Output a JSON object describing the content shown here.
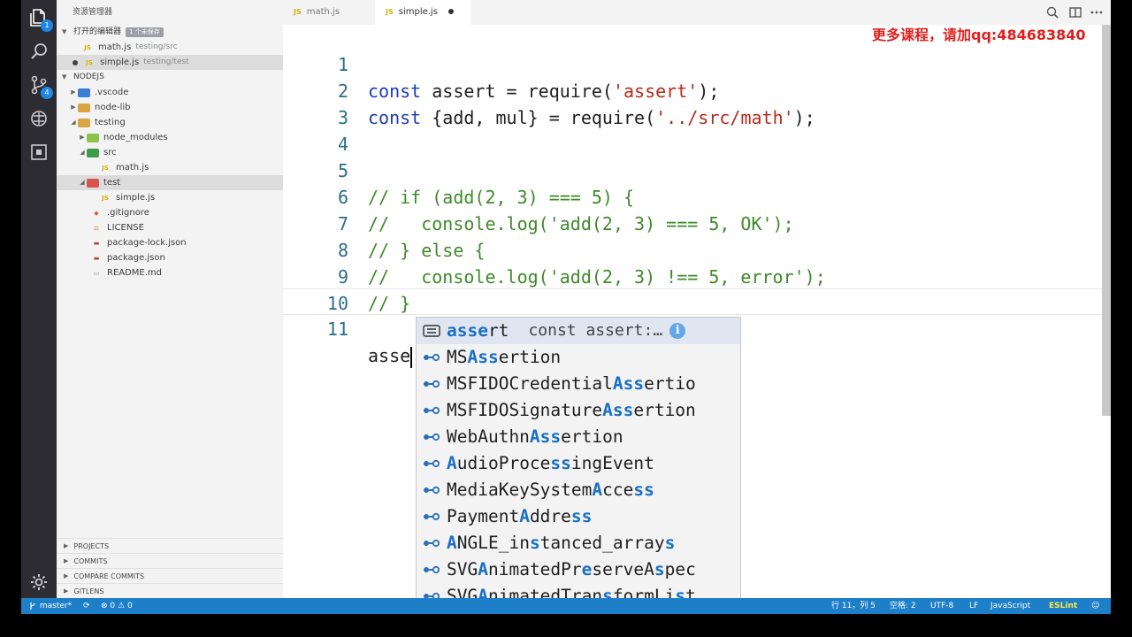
{
  "sidebar": {
    "title": "资源管理器",
    "open_editors": {
      "label": "打开的编辑器",
      "badge": "1 个未保存",
      "items": [
        {
          "name": "math.js",
          "path": "testing/src",
          "modified": false
        },
        {
          "name": "simple.js",
          "path": "testing/test",
          "modified": true
        }
      ]
    },
    "project": {
      "label": "NODEJS",
      "tree": [
        {
          "label": ".vscode"
        },
        {
          "label": "node-lib"
        },
        {
          "label": "testing"
        },
        {
          "label": "node_modules"
        },
        {
          "label": "src"
        },
        {
          "label": "math.js"
        },
        {
          "label": "test"
        },
        {
          "label": "simple.js"
        },
        {
          "label": ".gitignore"
        },
        {
          "label": "LICENSE"
        },
        {
          "label": "package-lock.json"
        },
        {
          "label": "package.json"
        },
        {
          "label": "README.md"
        }
      ]
    },
    "panels": [
      "PROJECTS",
      "COMMITS",
      "COMPARE COMMITS",
      "GITLENS"
    ]
  },
  "activity": {
    "explorer_badge": "1",
    "git_badge": "4"
  },
  "tabs": [
    {
      "label": "math.js",
      "active": false
    },
    {
      "label": "simple.js",
      "active": true,
      "modified": true
    }
  ],
  "watermark": "更多课程，请加qq:484683840",
  "code": {
    "line_numbers": [
      "1",
      "2",
      "3",
      "4",
      "5",
      "6",
      "7",
      "8",
      "9",
      "10",
      "11"
    ],
    "l1": {
      "kw": "const",
      "a": " assert = require(",
      "s": "'assert'",
      "b": ");"
    },
    "l2": {
      "kw": "const",
      "a": " {add, mul} = require(",
      "s": "'../src/math'",
      "b": ");"
    },
    "l5": "// if (add(2, 3) === 5) {",
    "l6": "//   console.log('add(2, 3) === 5, OK');",
    "l7": "// } else {",
    "l8": "//   console.log('add(2, 3) !== 5, error');",
    "l9": "// }",
    "l11": "asse"
  },
  "suggest": {
    "first": {
      "match": "asse",
      "rest": "rt",
      "detail": "const assert:…"
    },
    "items": [
      [
        [
          "MS",
          ""
        ],
        [
          "Ass",
          "h"
        ],
        [
          "ertion",
          ""
        ]
      ],
      [
        [
          "MSFIDOCredential",
          ""
        ],
        [
          "Ass",
          "h"
        ],
        [
          "ertio",
          ""
        ]
      ],
      [
        [
          "MSFIDOSignature",
          ""
        ],
        [
          "Ass",
          "h"
        ],
        [
          "ertion",
          ""
        ]
      ],
      [
        [
          "WebAuthn",
          ""
        ],
        [
          "Ass",
          "h"
        ],
        [
          "ertion",
          ""
        ]
      ],
      [
        [
          "A",
          "h"
        ],
        [
          "udioProce",
          ""
        ],
        [
          "ss",
          "h"
        ],
        [
          "ingEvent",
          ""
        ]
      ],
      [
        [
          "MediaKeySystem",
          ""
        ],
        [
          "A",
          "h"
        ],
        [
          "cce",
          ""
        ],
        [
          "ss",
          "h"
        ]
      ],
      [
        [
          "Payment",
          ""
        ],
        [
          "A",
          "h"
        ],
        [
          "ddre",
          ""
        ],
        [
          "ss",
          "h"
        ]
      ],
      [
        [
          "A",
          "h"
        ],
        [
          "NGLE_in",
          ""
        ],
        [
          "s",
          "h"
        ],
        [
          "tanced_array",
          ""
        ],
        [
          "s",
          "h"
        ]
      ],
      [
        [
          "SVG",
          ""
        ],
        [
          "A",
          "h"
        ],
        [
          "nimatedPr",
          ""
        ],
        [
          "e",
          "h"
        ],
        [
          "serveA",
          ""
        ],
        [
          "s",
          "h"
        ],
        [
          "pec",
          ""
        ]
      ],
      [
        [
          "SVG",
          ""
        ],
        [
          "A",
          "h"
        ],
        [
          "nimatedTran",
          ""
        ],
        [
          "s",
          "h"
        ],
        [
          "formLi",
          ""
        ],
        [
          "s",
          "h"
        ],
        [
          "t",
          ""
        ]
      ]
    ]
  },
  "status": {
    "branch": "master*",
    "errors": "0",
    "warnings": "0",
    "position": "行 11，列 5",
    "spaces": "空格: 2",
    "encoding": "UTF-8",
    "eol": "LF",
    "language": "JavaScript",
    "linter": "ESLint"
  },
  "colors": {
    "status_bar": "#1e7fc9",
    "activity_bar": "#2c2c32",
    "keyword": "#1b3db8",
    "string": "#b52a1d",
    "comment": "#3f8a2b",
    "match": "#1a6fc6"
  }
}
